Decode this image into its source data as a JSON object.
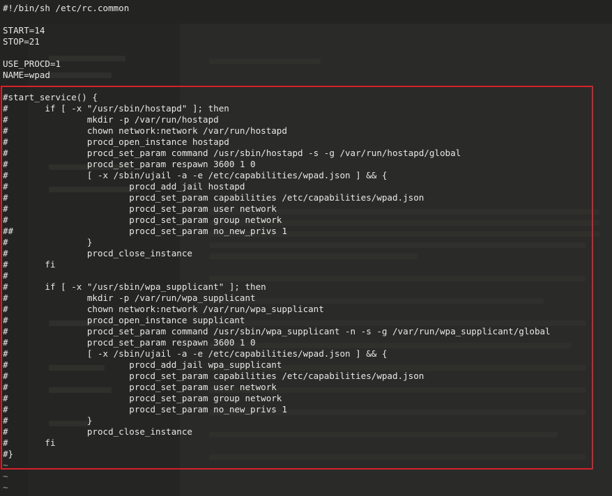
{
  "window": {
    "title": "#!/bin/sh /etc/rc.common"
  },
  "file_lines": [
    "#!/bin/sh /etc/rc.common",
    "",
    "START=14",
    "STOP=21",
    "",
    "USE_PROCD=1",
    "NAME=wpad",
    "",
    "#start_service() {",
    "#       if [ -x \"/usr/sbin/hostapd\" ]; then",
    "#               mkdir -p /var/run/hostapd",
    "#               chown network:network /var/run/hostapd",
    "#               procd_open_instance hostapd",
    "#               procd_set_param command /usr/sbin/hostapd -s -g /var/run/hostapd/global",
    "#               procd_set_param respawn 3600 1 0",
    "#               [ -x /sbin/ujail -a -e /etc/capabilities/wpad.json ] && {",
    "#                       procd_add_jail hostapd",
    "#                       procd_set_param capabilities /etc/capabilities/wpad.json",
    "#                       procd_set_param user network",
    "#                       procd_set_param group network",
    "##                      procd_set_param no_new_privs 1",
    "#               }",
    "#               procd_close_instance",
    "#       fi",
    "#",
    "#       if [ -x \"/usr/sbin/wpa_supplicant\" ]; then",
    "#               mkdir -p /var/run/wpa_supplicant",
    "#               chown network:network /var/run/wpa_supplicant",
    "#               procd_open_instance supplicant",
    "#               procd_set_param command /usr/sbin/wpa_supplicant -n -s -g /var/run/wpa_supplicant/global",
    "#               procd_set_param respawn 3600 1 0",
    "#               [ -x /sbin/ujail -a -e /etc/capabilities/wpad.json ] && {",
    "#                       procd_add_jail wpa_supplicant",
    "#                       procd_set_param capabilities /etc/capabilities/wpad.json",
    "#                       procd_set_param user network",
    "#                       procd_set_param group network",
    "#                       procd_set_param no_new_privs 1",
    "#               }",
    "#               procd_close_instance",
    "#       fi",
    "#}"
  ],
  "empty_line_markers": [
    "~",
    "~",
    "~"
  ],
  "colors": {
    "background": "#232321",
    "text": "#e8e8e6",
    "tilde": "#9aa0a6",
    "highlight_border": "#d8202a"
  }
}
